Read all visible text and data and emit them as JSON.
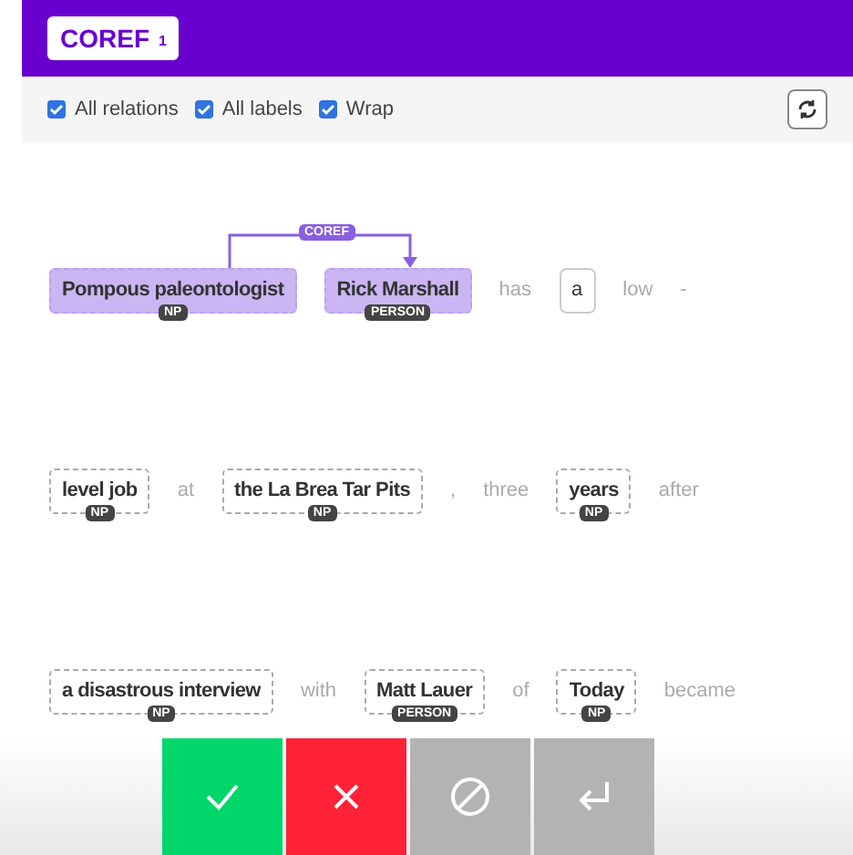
{
  "header": {
    "title": "COREF",
    "count": "1"
  },
  "options": [
    {
      "label": "All relations",
      "checked": true
    },
    {
      "label": "All labels",
      "checked": true
    },
    {
      "label": "Wrap",
      "checked": true
    }
  ],
  "lines": [
    {
      "relation": {
        "label": "COREF"
      },
      "tokens": [
        {
          "kind": "span",
          "text": "Pompous paleontologist",
          "label": "NP",
          "highlighted": true
        },
        {
          "kind": "span",
          "text": "Rick Marshall",
          "label": "PERSON",
          "highlighted": true
        },
        {
          "kind": "word",
          "text": "has"
        },
        {
          "kind": "boxed",
          "text": "a"
        },
        {
          "kind": "word",
          "text": "low"
        },
        {
          "kind": "word",
          "text": "-"
        }
      ]
    },
    {
      "tokens": [
        {
          "kind": "span",
          "text": "level job",
          "label": "NP",
          "highlighted": false
        },
        {
          "kind": "word",
          "text": "at"
        },
        {
          "kind": "span",
          "text": "the La Brea Tar Pits",
          "label": "NP",
          "highlighted": false
        },
        {
          "kind": "word",
          "text": ","
        },
        {
          "kind": "word",
          "text": "three"
        },
        {
          "kind": "span",
          "text": "years",
          "label": "NP",
          "highlighted": false
        },
        {
          "kind": "word",
          "text": "after"
        }
      ]
    },
    {
      "tokens": [
        {
          "kind": "span",
          "text": "a disastrous interview",
          "label": "NP",
          "highlighted": false
        },
        {
          "kind": "word",
          "text": "with"
        },
        {
          "kind": "span",
          "text": "Matt Lauer",
          "label": "PERSON",
          "highlighted": false
        },
        {
          "kind": "word",
          "text": "of"
        },
        {
          "kind": "span",
          "text": "Today",
          "label": "NP",
          "highlighted": false
        },
        {
          "kind": "word",
          "text": "became"
        }
      ]
    }
  ],
  "actions": [
    {
      "kind": "accept"
    },
    {
      "kind": "reject"
    },
    {
      "kind": "ignore"
    },
    {
      "kind": "undo"
    }
  ]
}
